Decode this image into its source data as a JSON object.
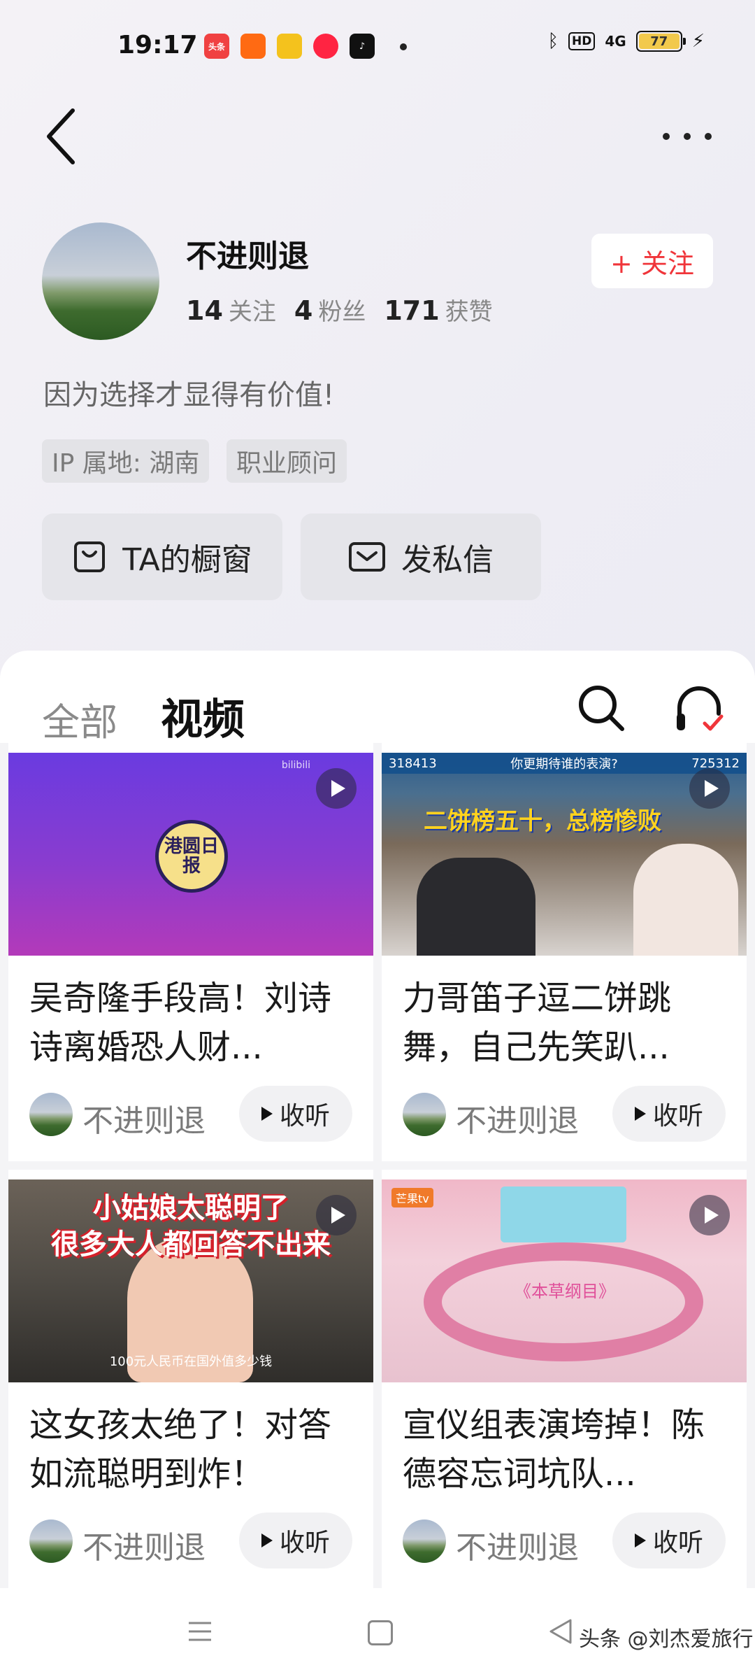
{
  "status_bar": {
    "time": "19:17",
    "apps": [
      {
        "name": "toutiao-app-icon",
        "label": "头条",
        "color": "#f04142"
      },
      {
        "name": "kuaishou-app-icon",
        "label": "",
        "color": "#ff6a13"
      },
      {
        "name": "yellow-app-icon",
        "label": "",
        "color": "#f4c21d"
      },
      {
        "name": "red-play-app-icon",
        "label": "",
        "color": "#ff2442"
      },
      {
        "name": "tiktok-app-icon",
        "label": "",
        "color": "#111111"
      }
    ],
    "hd": "HD",
    "network": "4G",
    "battery": "77"
  },
  "header": {
    "back": "<",
    "more": "..."
  },
  "profile": {
    "name": "不进则退",
    "following_count": "14",
    "following_label": "关注",
    "followers_count": "4",
    "followers_label": "粉丝",
    "likes_count": "171",
    "likes_label": "获赞",
    "follow_button": "+ 关注",
    "bio": "因为选择才显得有价值!",
    "tags": [
      "IP 属地: 湖南",
      "职业顾问"
    ],
    "showcase_button": "TA的橱窗",
    "message_button": "发私信"
  },
  "tabs": {
    "all": "全部",
    "video": "视频"
  },
  "videos": [
    {
      "title": "吴奇隆手段高！刘诗诗离婚恐人财...",
      "author": "不进则退",
      "listen": "收听",
      "thumb": {
        "logo": "港圆日报",
        "mark": "bilibili"
      }
    },
    {
      "title": "力哥笛子逗二饼跳舞，自己先笑趴...",
      "author": "不进则退",
      "listen": "收听",
      "thumb": {
        "top_left": "318413",
        "top_mid": "你更期待谁的表演?",
        "top_right": "725312",
        "banner": "二饼榜五十，总榜惨败"
      }
    },
    {
      "title": "这女孩太绝了！对答如流聪明到炸！",
      "author": "不进则退",
      "listen": "收听",
      "thumb": {
        "cap1": "小姑娘太聪明了",
        "cap2": "很多大人都回答不出来",
        "sub": "100元人民币在国外值多少钱"
      }
    },
    {
      "title": "宣仪组表演垮掉！陈德容忘词坑队...",
      "author": "不进则退",
      "listen": "收听",
      "thumb": {
        "logo": "芒果tv",
        "show": "《本草纲目》"
      }
    }
  ],
  "watermark": "头条 @刘杰爱旅行"
}
